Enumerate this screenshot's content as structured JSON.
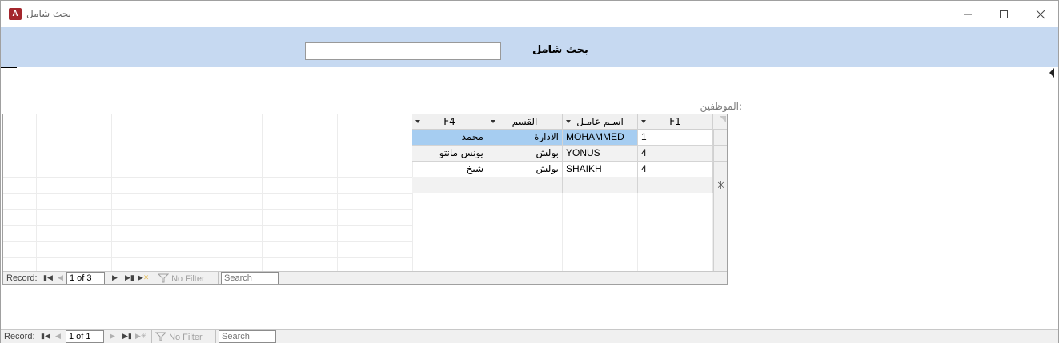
{
  "window": {
    "title": "بحث شامل",
    "app_icon_letter": "A"
  },
  "header": {
    "search_label": "بحث شامل",
    "search_value": ""
  },
  "subform": {
    "label": "الموظفين:",
    "columns": [
      "F1",
      "اسـم عامـل",
      "القسم",
      "F4"
    ],
    "rows": [
      {
        "F1": "1",
        "name": "MOHAMMED",
        "dept": "الادارة",
        "F4": "محمد"
      },
      {
        "F1": "4",
        "name": "YONUS",
        "dept": "بولش",
        "F4": "يونس مانتو"
      },
      {
        "F1": "4",
        "name": "SHAIKH",
        "dept": "بولش",
        "F4": "شيخ"
      }
    ],
    "new_row_marker": "✳",
    "nav": {
      "record_label": "Record:",
      "position": "1 of 3",
      "filter_label": "No Filter",
      "search_placeholder": "Search"
    }
  },
  "main_nav": {
    "record_label": "Record:",
    "position": "1 of 1",
    "filter_label": "No Filter",
    "search_placeholder": "Search"
  },
  "colors": {
    "header_band": "#c6d9f1",
    "selected_cell": "#a6cdf1",
    "access_red": "#a4262c"
  }
}
